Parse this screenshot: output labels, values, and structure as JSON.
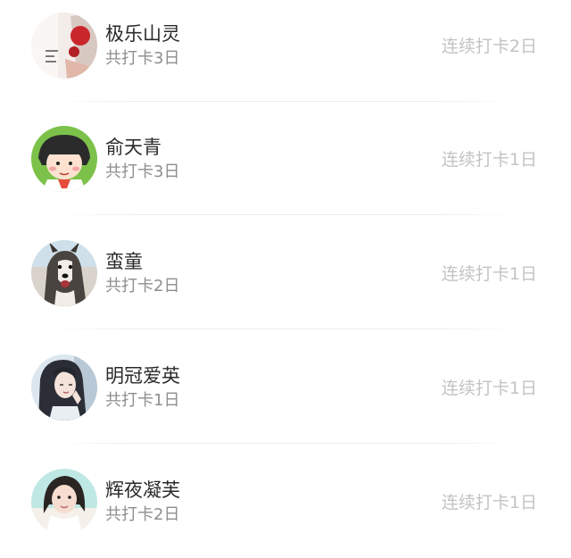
{
  "checkin_list": {
    "items": [
      {
        "name": "极乐山灵",
        "total": "共打卡3日",
        "streak": "连续打卡2日",
        "avatar_icon": "avatar-red-pattern-icon"
      },
      {
        "name": "俞天青",
        "total": "共打卡3日",
        "streak": "连续打卡1日",
        "avatar_icon": "avatar-cartoon-girl-icon"
      },
      {
        "name": "蛮童",
        "total": "共打卡2日",
        "streak": "连续打卡1日",
        "avatar_icon": "avatar-husky-dog-icon"
      },
      {
        "name": "明冠爱英",
        "total": "共打卡1日",
        "streak": "连续打卡1日",
        "avatar_icon": "avatar-long-hair-girl-icon"
      },
      {
        "name": "辉夜凝芙",
        "total": "共打卡2日",
        "streak": "连续打卡1日",
        "avatar_icon": "avatar-portrait-girl-icon"
      }
    ]
  },
  "colors": {
    "name_text": "#2a2a2a",
    "total_text": "#8e8e8e",
    "streak_text": "#c3c3c3",
    "divider": "#ececec"
  }
}
